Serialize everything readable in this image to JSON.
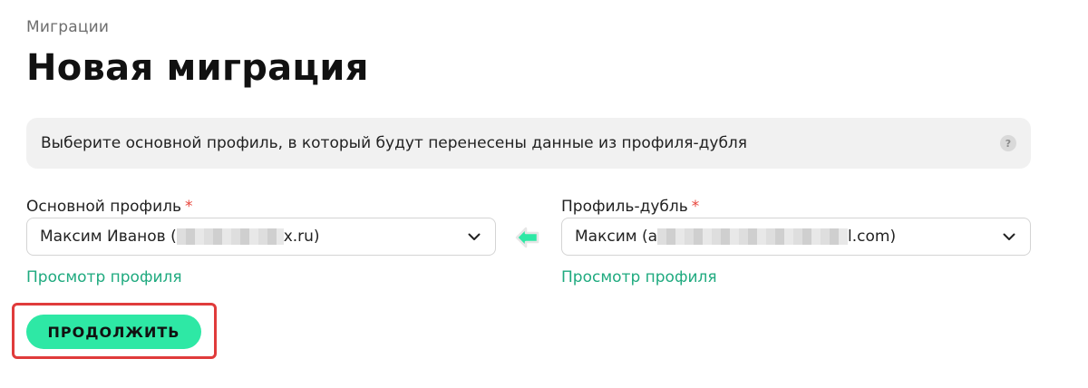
{
  "breadcrumb": "Миграции",
  "title": "Новая миграция",
  "info": {
    "text": "Выберите основной профиль, в который будут перенесены данные из профиля-дубля",
    "help_glyph": "?"
  },
  "main_profile": {
    "label": "Основной профиль",
    "required_mark": "*",
    "value_prefix": "Максим Иванов (",
    "value_suffix": "x.ru)",
    "view_link": "Просмотр профиля"
  },
  "duplicate_profile": {
    "label": "Профиль-дубль",
    "required_mark": "*",
    "value_prefix": "Максим (a",
    "value_suffix": "l.com)",
    "view_link": "Просмотр профиля"
  },
  "continue_button": "ПРОДОЛЖИТЬ",
  "colors": {
    "accent": "#2ee8a5",
    "link": "#1faa7f",
    "required": "#e8453c",
    "highlight_frame": "#e03b3b"
  },
  "icons": {
    "help": "question-icon",
    "dropdown": "chevron-down-icon",
    "swap": "arrow-left-icon"
  }
}
